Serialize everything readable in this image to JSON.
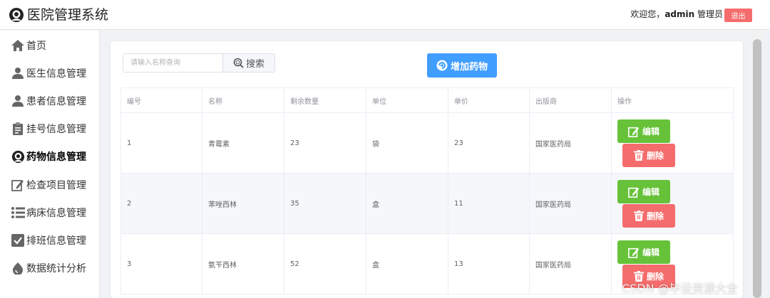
{
  "header": {
    "title": "医院管理系统",
    "welcome_prefix": "欢迎您，",
    "username": "admin",
    "role": " 管理员",
    "logout_label": "退出"
  },
  "sidebar": {
    "items": [
      {
        "label": "首页",
        "icon": "home-icon"
      },
      {
        "label": "医生信息管理",
        "icon": "user-icon"
      },
      {
        "label": "患者信息管理",
        "icon": "user-icon"
      },
      {
        "label": "挂号信息管理",
        "icon": "document-icon"
      },
      {
        "label": "药物信息管理",
        "icon": "app-logo-icon",
        "active": true
      },
      {
        "label": "检查项目管理",
        "icon": "edit-icon"
      },
      {
        "label": "病床信息管理",
        "icon": "list-icon"
      },
      {
        "label": "排班信息管理",
        "icon": "checkbox-icon"
      },
      {
        "label": "数据统计分析",
        "icon": "drop-icon"
      }
    ]
  },
  "toolbar": {
    "search_placeholder": "请输入名称查询",
    "search_label": "搜索",
    "add_label": "增加药物"
  },
  "table": {
    "columns": [
      "编号",
      "名称",
      "剩余数量",
      "单位",
      "单价",
      "出版商",
      "操作"
    ],
    "rows": [
      {
        "id": "1",
        "name": "青霉素",
        "quantity": "23",
        "unit": "袋",
        "price": "23",
        "publisher": "国家医药局"
      },
      {
        "id": "2",
        "name": "苯唑西林",
        "quantity": "35",
        "unit": "盒",
        "price": "11",
        "publisher": "国家医药局"
      },
      {
        "id": "3",
        "name": "氨苄西林",
        "quantity": "52",
        "unit": "盒",
        "price": "13",
        "publisher": "国家医药局"
      }
    ],
    "edit_label": "编辑",
    "delete_label": "删除"
  },
  "watermark": "CSDN @毕设资源大全",
  "colors": {
    "primary": "#409eff",
    "success": "#67c23a",
    "danger": "#f56c6c"
  }
}
